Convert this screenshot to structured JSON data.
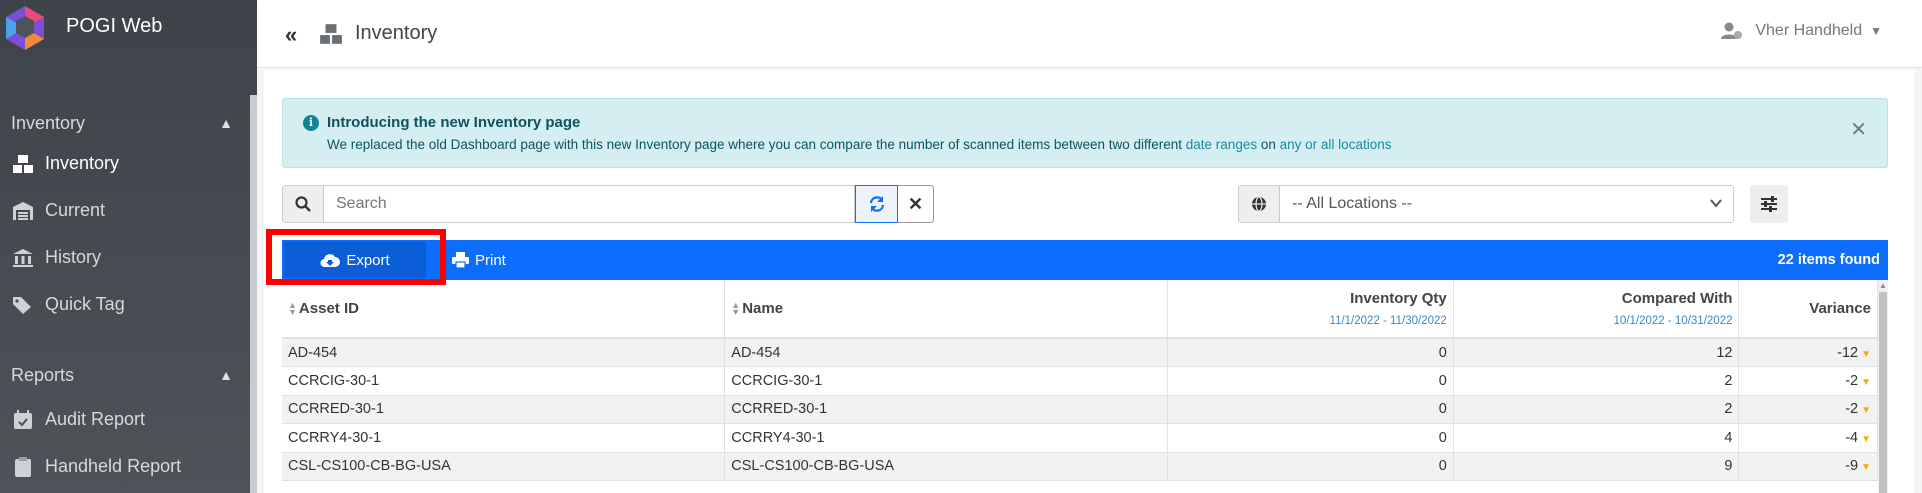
{
  "app": {
    "name": "POGI Web"
  },
  "sidebar": {
    "sections": [
      {
        "label": "Inventory",
        "items": [
          {
            "label": "Inventory",
            "icon": "inventory-icon",
            "active": true
          },
          {
            "label": "Current",
            "icon": "warehouse-icon"
          },
          {
            "label": "History",
            "icon": "bank-icon"
          },
          {
            "label": "Quick Tag",
            "icon": "tags-icon"
          }
        ]
      },
      {
        "label": "Reports",
        "items": [
          {
            "label": "Audit Report",
            "icon": "calendar-check-icon"
          },
          {
            "label": "Handheld Report",
            "icon": "clipboard-icon"
          }
        ]
      }
    ]
  },
  "header": {
    "title": "Inventory",
    "user": "Vher Handheld"
  },
  "alert": {
    "title": "Introducing the new Inventory page",
    "body_prefix": "We replaced the old Dashboard page with this new Inventory page where you can compare the number of scanned items between two different",
    "link1": "date ranges",
    "body_mid": "on",
    "link2": "any or all locations"
  },
  "search": {
    "placeholder": "Search"
  },
  "location": {
    "selected": "-- All Locations --"
  },
  "toolbar": {
    "export_label": "Export",
    "print_label": "Print",
    "count_text": "22 items found"
  },
  "table": {
    "columns": {
      "asset_id": "Asset ID",
      "name": "Name",
      "inventory_qty": "Inventory Qty",
      "inventory_range": "11/1/2022 - 11/30/2022",
      "compared_with": "Compared With",
      "compared_range": "10/1/2022 - 10/31/2022",
      "variance": "Variance"
    },
    "rows": [
      {
        "asset_id": "AD-454",
        "name": "AD-454",
        "inventory_qty": "0",
        "compared_with": "12",
        "variance": "-12"
      },
      {
        "asset_id": "CCRCIG-30-1",
        "name": "CCRCIG-30-1",
        "inventory_qty": "0",
        "compared_with": "2",
        "variance": "-2"
      },
      {
        "asset_id": "CCRRED-30-1",
        "name": "CCRRED-30-1",
        "inventory_qty": "0",
        "compared_with": "2",
        "variance": "-2"
      },
      {
        "asset_id": "CCRRY4-30-1",
        "name": "CCRRY4-30-1",
        "inventory_qty": "0",
        "compared_with": "4",
        "variance": "-4"
      },
      {
        "asset_id": "CSL-CS100-CB-BG-USA",
        "name": "CSL-CS100-CB-BG-USA",
        "inventory_qty": "0",
        "compared_with": "9",
        "variance": "-9"
      }
    ]
  }
}
